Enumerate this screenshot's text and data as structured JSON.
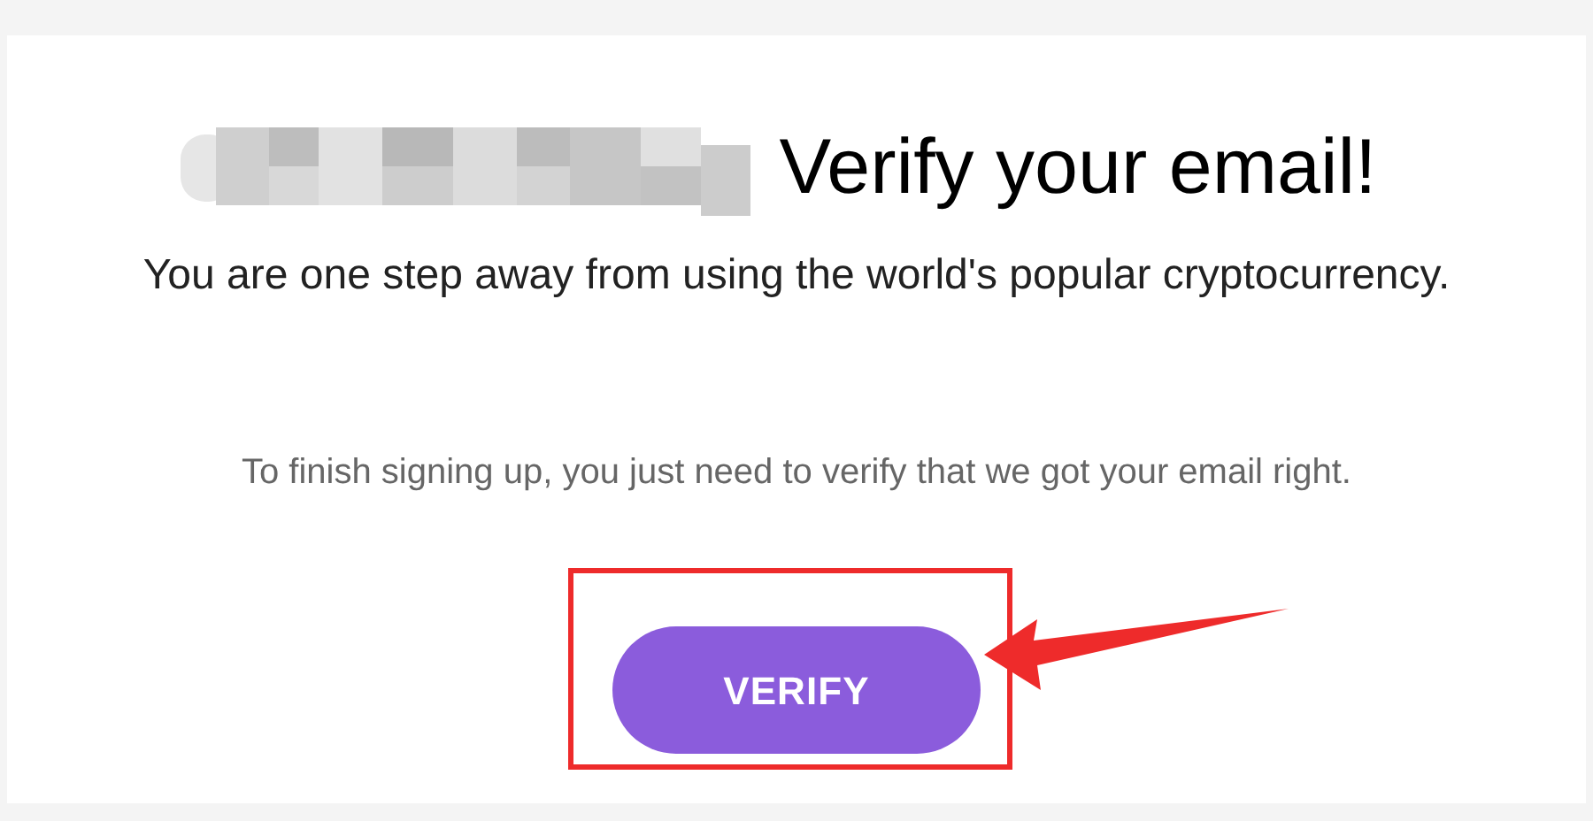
{
  "heading": "Verify your email!",
  "subtitle": "You are one step away from using the world's popular cryptocurrency.",
  "body": "To finish signing up, you just need to verify that we got your email right.",
  "button": {
    "label": "VERIFY"
  }
}
